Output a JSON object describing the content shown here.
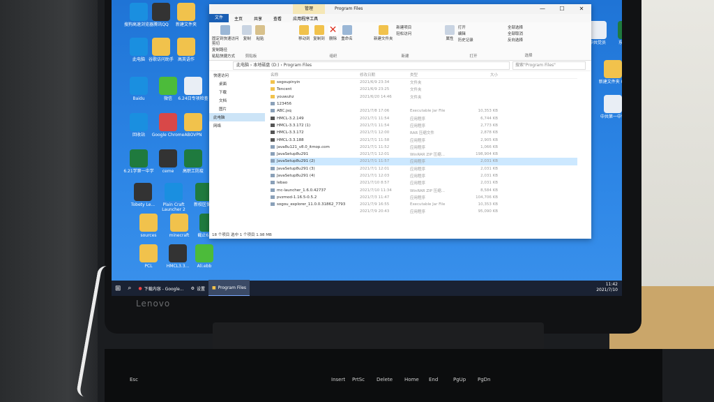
{
  "desktop": {
    "left_icons": [
      {
        "label": "搜狗高速浏览器",
        "icon": "sogou-browser-icon",
        "color": "#1a8fe0"
      },
      {
        "label": "腾讯QQ",
        "icon": "qq-icon",
        "color": "#333333"
      },
      {
        "label": "新建文件夹",
        "icon": "folder-icon",
        "color": "#f1c24c"
      },
      {
        "label": "此电脑",
        "icon": "computer-icon",
        "color": "#1a8fe0"
      },
      {
        "label": "谷歌访问助手",
        "icon": "folder-icon",
        "color": "#f1c24c"
      },
      {
        "label": "高英语作",
        "icon": "folder-icon",
        "color": "#f1c24c"
      },
      {
        "label": "Baidu",
        "icon": "baidu-icon",
        "color": "#1a8fe0"
      },
      {
        "label": "微信",
        "icon": "wechat-icon",
        "color": "#4cbb3a"
      },
      {
        "label": "6.24日专项检查",
        "icon": "document-icon",
        "color": "#e9eef5"
      },
      {
        "label": "回收站",
        "icon": "recycle-bin-icon",
        "color": "#1a8fe0"
      },
      {
        "label": "Google Chrome",
        "icon": "chrome-icon",
        "color": "#d84848"
      },
      {
        "label": "ABOVPN",
        "icon": "folder-icon",
        "color": "#f1c24c"
      },
      {
        "label": "6.21学第一中学",
        "icon": "excel-icon",
        "color": "#1f7a3e"
      },
      {
        "label": "ceme",
        "icon": "app-icon",
        "color": "#333333"
      },
      {
        "label": "高职工防疫",
        "icon": "excel-icon",
        "color": "#1f7a3e"
      },
      {
        "label": "Tobety Le...",
        "icon": "app-icon",
        "color": "#333333"
      },
      {
        "label": "Plain Craft Launcher 2",
        "icon": "pcl-icon",
        "color": "#1a8fe0"
      },
      {
        "label": "新校区保洁",
        "icon": "excel-icon",
        "color": "#1f7a3e"
      },
      {
        "label": "sources",
        "icon": "folder-icon",
        "color": "#f1c24c"
      },
      {
        "label": "minecraft",
        "icon": "folder-icon",
        "color": "#f1c24c"
      },
      {
        "label": "截止6.24日",
        "icon": "excel-icon",
        "color": "#1f7a3e"
      },
      {
        "label": "PCL",
        "icon": "folder-icon",
        "color": "#f1c24c"
      },
      {
        "label": "HMCL3.3...",
        "icon": "minecraft-icon",
        "color": "#333333"
      },
      {
        "label": "Ali.ebb",
        "icon": "app-icon",
        "color": "#4cbb3a"
      }
    ],
    "right_icons": [
      {
        "label": "中共党员",
        "icon": "document-icon",
        "color": "#e9eef5"
      },
      {
        "label": "东宋卫生",
        "icon": "excel-icon",
        "color": "#1f7a3e"
      },
      {
        "label": "新建文件夹 (2)",
        "icon": "folder-icon",
        "color": "#f1c24c"
      },
      {
        "label": "中共第一中学",
        "icon": "document-icon",
        "color": "#e9eef5"
      }
    ]
  },
  "window": {
    "manage_tab": "管理",
    "title": "Program Files",
    "tabs": [
      "文件",
      "主页",
      "共享",
      "查看",
      "应用程序工具"
    ],
    "ribbon": {
      "pin": "固定到快速访问",
      "copy": "复制",
      "paste": "粘贴",
      "cut": "剪切",
      "copy_path": "复制路径",
      "paste_shortcut": "粘贴快捷方式",
      "clipboard": "剪贴板",
      "move_to": "移动到",
      "copy_to": "复制到",
      "delete": "删除",
      "rename": "重命名",
      "organize": "组织",
      "new_folder": "新建文件夹",
      "new_item": "新建项目",
      "easy_access": "轻松访问",
      "new": "新建",
      "properties": "属性",
      "open": "打开",
      "edit": "编辑",
      "history": "历史记录",
      "open_group": "打开",
      "select_all": "全部选择",
      "select_none": "全部取消",
      "invert": "反向选择",
      "select": "选择"
    },
    "address": {
      "path": "此电脑  ›  本地磁盘 (D:)  ›  Program Files",
      "search_placeholder": "搜索\"Program Files\""
    },
    "nav": [
      "快速访问",
      "桌面",
      "下载",
      "文档",
      "图片",
      "此电脑",
      "网络"
    ],
    "headers": [
      "名称",
      "修改日期",
      "类型",
      "大小"
    ],
    "files": [
      {
        "name": "sogoupinyin",
        "date": "2021/6/9 23:34",
        "type": "文件夹",
        "size": "",
        "kind": "folder"
      },
      {
        "name": "Tencent",
        "date": "2021/6/9 23:25",
        "type": "文件夹",
        "size": "",
        "kind": "folder"
      },
      {
        "name": "youwuhz",
        "date": "2021/6/20 14:46",
        "type": "文件夹",
        "size": "",
        "kind": "folder"
      },
      {
        "name": "123456",
        "date": "",
        "type": "",
        "size": "",
        "kind": "file"
      },
      {
        "name": "ABC.jsq",
        "date": "2021/7/8 17:06",
        "type": "Executable Jar File",
        "size": "10,353 KB",
        "kind": "file"
      },
      {
        "name": "HMCL-3.2.149",
        "date": "2021/7/1 11:54",
        "type": "应用程序",
        "size": "6,744 KB",
        "kind": "app"
      },
      {
        "name": "HMCL-3.3.172 (1)",
        "date": "2021/7/1 11:54",
        "type": "应用程序",
        "size": "2,773 KB",
        "kind": "app"
      },
      {
        "name": "HMCL-3.3.172",
        "date": "2021/7/1 12:00",
        "type": "RAR 压缩文件",
        "size": "2,878 KB",
        "kind": "app"
      },
      {
        "name": "HMCL-3.3.188",
        "date": "2021/7/1 11:58",
        "type": "应用程序",
        "size": "2,905 KB",
        "kind": "app"
      },
      {
        "name": "java8u121_v8.0_itmop.com",
        "date": "2021/7/1 11:52",
        "type": "应用程序",
        "size": "1,066 KB",
        "kind": "file"
      },
      {
        "name": "JavaSetup8u291",
        "date": "2021/7/1 12:01",
        "type": "WinRAR ZIP 压缩...",
        "size": "198,904 KB",
        "kind": "file"
      },
      {
        "name": "JavaSetup8u291 (2)",
        "date": "2021/7/1 11:57",
        "type": "应用程序",
        "size": "2,031 KB",
        "kind": "file"
      },
      {
        "name": "JavaSetup8u291 (3)",
        "date": "2021/7/1 12:01",
        "type": "应用程序",
        "size": "2,031 KB",
        "kind": "file"
      },
      {
        "name": "JavaSetup8u291 (4)",
        "date": "2021/7/1 12:03",
        "type": "应用程序",
        "size": "2,031 KB",
        "kind": "file"
      },
      {
        "name": "lebao",
        "date": "2021/7/10 8:57",
        "type": "应用程序",
        "size": "2,031 KB",
        "kind": "file"
      },
      {
        "name": "mc-launcher_1.6.0.42737",
        "date": "2021/7/10 11:34",
        "type": "WinRAR ZIP 压缩...",
        "size": "8,584 KB",
        "kind": "file"
      },
      {
        "name": "pvzmod-1.16.5-0.5.2",
        "date": "2021/7/3 11:47",
        "type": "应用程序",
        "size": "104,706 KB",
        "kind": "file"
      },
      {
        "name": "sogou_explorer_11.0.0.31862_7793",
        "date": "2021/7/9 16:55",
        "type": "Executable Jar File",
        "size": "10,353 KB",
        "kind": "file"
      },
      {
        "name": "",
        "date": "2021/7/9 20:43",
        "type": "应用程序",
        "size": "95,090 KB",
        "kind": "blank"
      }
    ],
    "selected_row": 11,
    "status": "18 个项目    选中 1 个项目  1.98 MB"
  },
  "taskbar": {
    "items": [
      "下载内容 - Google...",
      "设置",
      "Program Files"
    ],
    "time": "11:42",
    "date": "2021/7/10"
  },
  "laptop": {
    "brand": "Lenovo",
    "keys": [
      "Esc",
      "Insert",
      "PrtSc",
      "Delete",
      "Home",
      "End",
      "PgUp",
      "PgDn"
    ]
  }
}
